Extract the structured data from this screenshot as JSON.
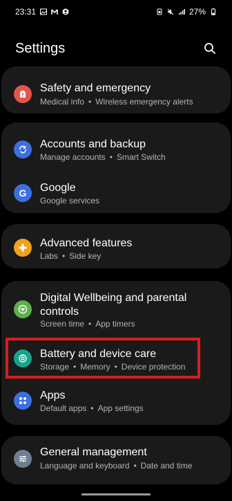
{
  "status": {
    "time": "23:31",
    "battery": "27%"
  },
  "header": {
    "title": "Settings"
  },
  "items": [
    {
      "title": "Safety and emergency",
      "sub": [
        "Medical info",
        "Wireless emergency alerts"
      ],
      "color": "#e2574c",
      "icon": "safety-icon"
    },
    {
      "title": "Accounts and backup",
      "sub": [
        "Manage accounts",
        "Smart Switch"
      ],
      "color": "#3d6fe0",
      "icon": "sync-icon"
    },
    {
      "title": "Google",
      "sub": [
        "Google services"
      ],
      "color": "#3d6fe0",
      "icon": "google-icon"
    },
    {
      "title": "Advanced features",
      "sub": [
        "Labs",
        "Side key"
      ],
      "color": "#f0a31f",
      "icon": "puzzle-icon"
    },
    {
      "title": "Digital Wellbeing and parental",
      "title2": "controls",
      "sub": [
        "Screen time",
        "App timers"
      ],
      "color": "#5fb04c",
      "icon": "heart-icon"
    },
    {
      "title": "Battery and device care",
      "sub": [
        "Storage",
        "Memory",
        "Device protection"
      ],
      "color": "#1aa28c",
      "icon": "device-care-icon"
    },
    {
      "title": "Apps",
      "sub": [
        "Default apps",
        "App settings"
      ],
      "color": "#3d6fe0",
      "icon": "apps-icon"
    },
    {
      "title": "General management",
      "sub": [
        "Language and keyboard",
        "Date and time"
      ],
      "color": "#6f7e92",
      "icon": "sliders-icon"
    }
  ]
}
